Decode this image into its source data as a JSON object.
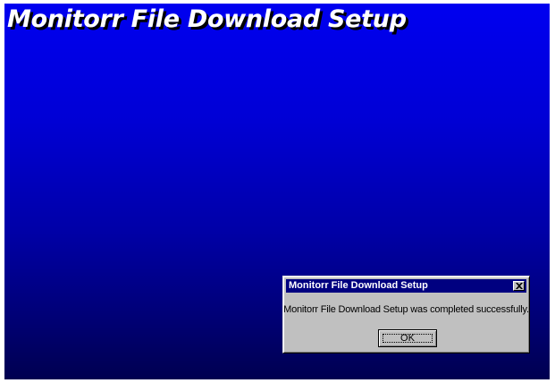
{
  "screen": {
    "title": "Monitorr File Download Setup",
    "background_top": "#0000f0",
    "background_bottom": "#000050"
  },
  "dialog": {
    "title": "Monitorr File Download Setup",
    "message": "Monitorr File Download Setup was completed successfully.",
    "ok_label": "OK",
    "close_icon": "close-icon",
    "titlebar_color": "#000080",
    "face_color": "#c0c0c0"
  }
}
